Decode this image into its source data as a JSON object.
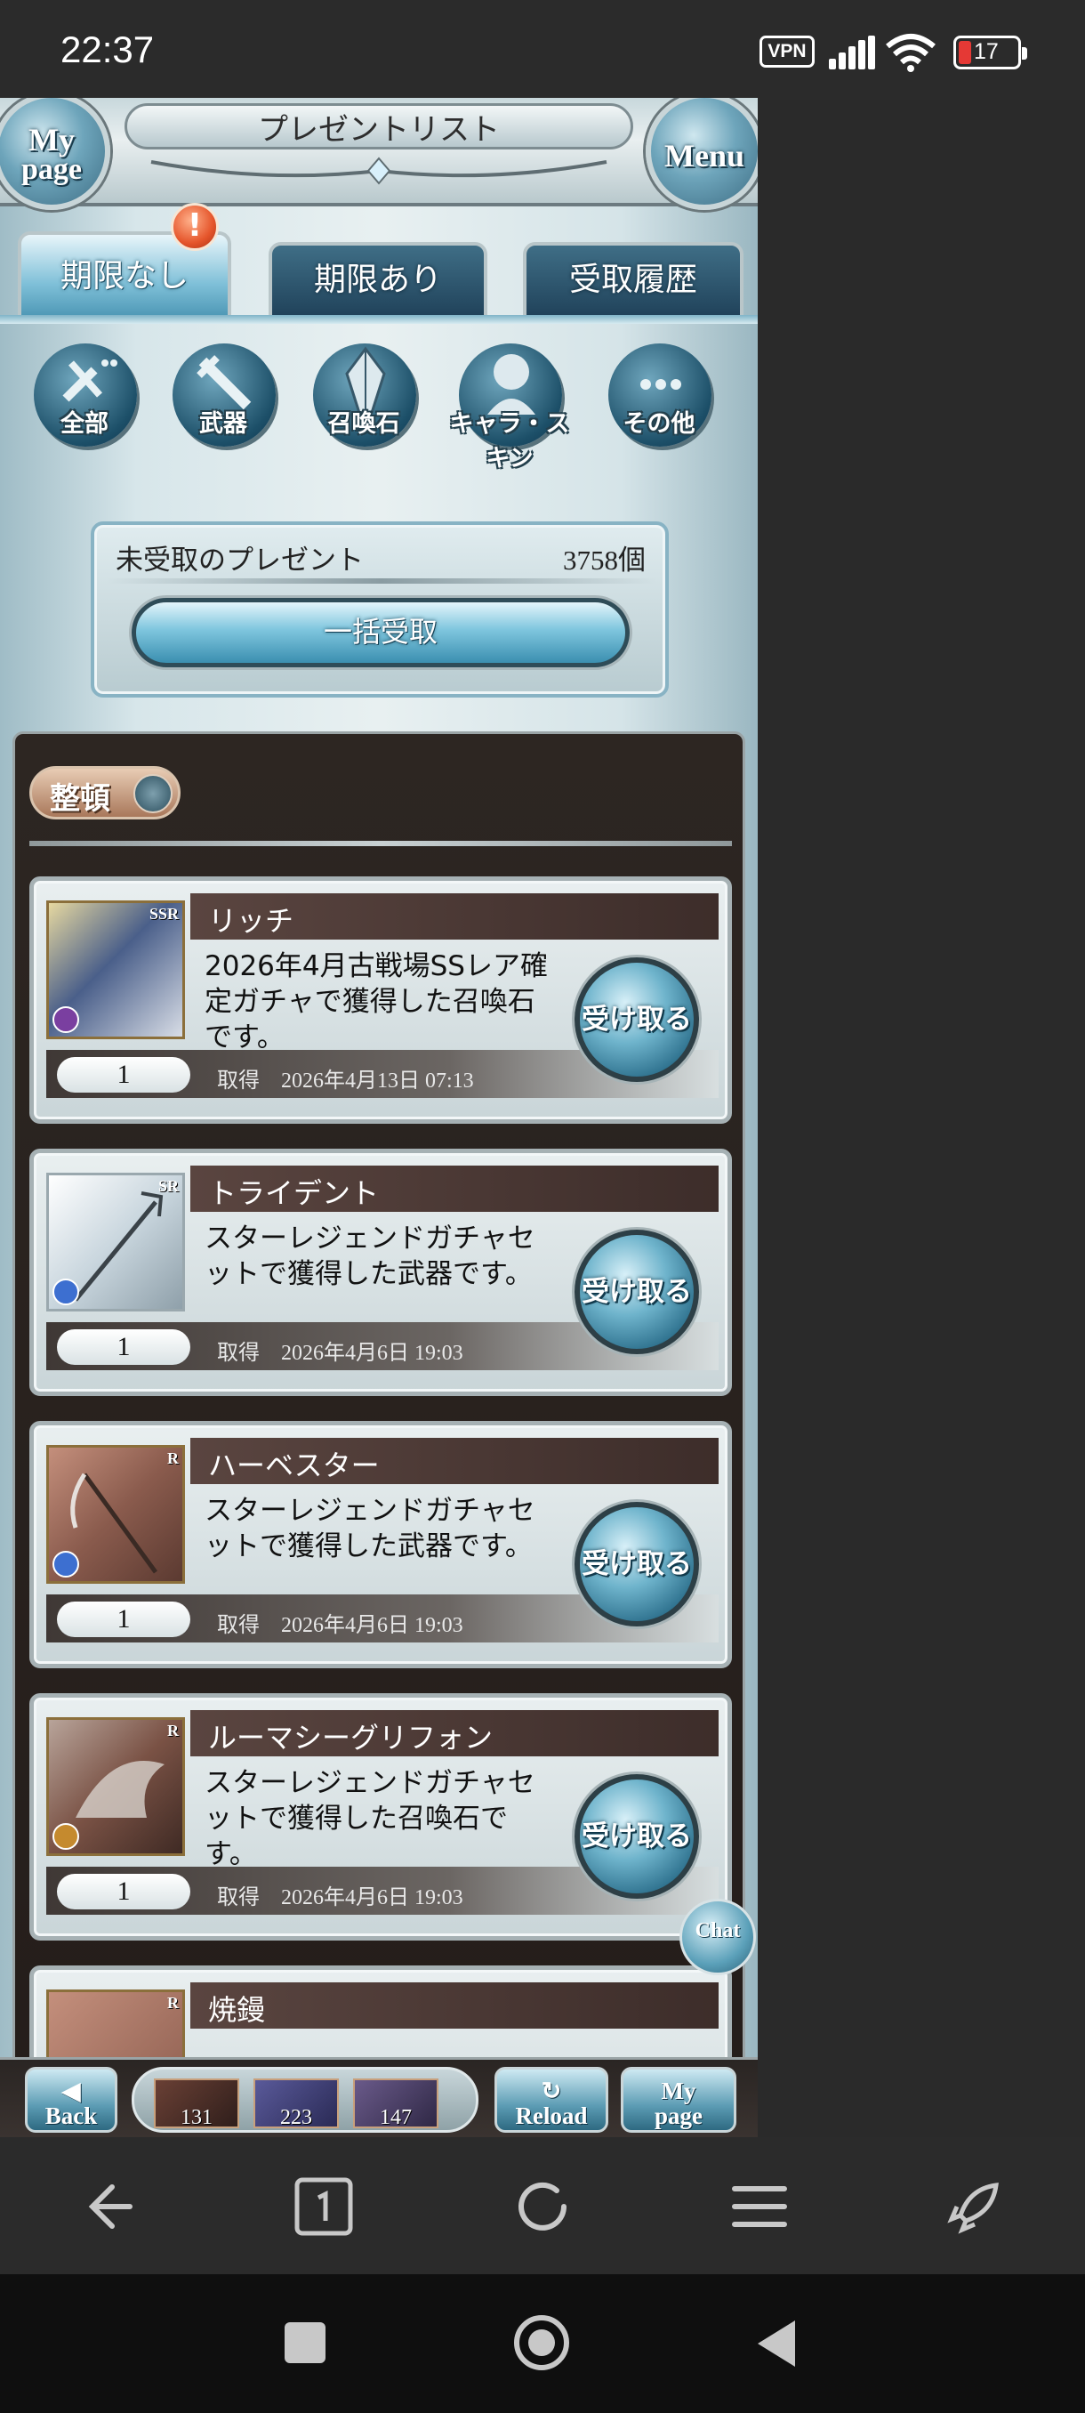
{
  "status_bar": {
    "time": "22:37",
    "vpn": "VPN",
    "battery": "17"
  },
  "header": {
    "title": "プレゼントリスト",
    "mypage_line1": "My",
    "mypage_line2": "page",
    "menu": "Menu"
  },
  "tabs": [
    {
      "label": "期限なし",
      "active": true,
      "badge": "!"
    },
    {
      "label": "期限あり",
      "active": false
    },
    {
      "label": "受取履歴",
      "active": false
    }
  ],
  "categories": [
    {
      "label": "全部",
      "icon": "all-items-icon"
    },
    {
      "label": "武器",
      "icon": "weapon-icon"
    },
    {
      "label": "召喚石",
      "icon": "summon-stone-icon"
    },
    {
      "label": "キャラ・スキン",
      "icon": "character-skin-icon"
    },
    {
      "label": "その他",
      "icon": "other-icon"
    }
  ],
  "receive": {
    "label": "未受取のプレゼント",
    "count": "3758個",
    "button": "一括受取"
  },
  "sort_label": "整頓",
  "items": [
    {
      "name": "リッチ",
      "rarity": "SSR",
      "desc": "2026年4月古戦場SSレア確定ガチャで獲得した召喚石です。",
      "qty": "1",
      "acquired_label": "取得",
      "acquired": "2026年4月13日 07:13",
      "button": "受け取る",
      "thumb_color": "#4a5f8a"
    },
    {
      "name": "トライデント",
      "rarity": "SR",
      "desc": "スターレジェンドガチャセットで獲得した武器です。",
      "qty": "1",
      "acquired_label": "取得",
      "acquired": "2026年4月6日 19:03",
      "button": "受け取る",
      "thumb_color": "#c9d6de"
    },
    {
      "name": "ハーベスター",
      "rarity": "R",
      "desc": "スターレジェンドガチャセットで獲得した武器です。",
      "qty": "1",
      "acquired_label": "取得",
      "acquired": "2026年4月6日 19:03",
      "button": "受け取る",
      "thumb_color": "#8a5b4d"
    },
    {
      "name": "ルーマシーグリフォン",
      "rarity": "R",
      "desc": "スターレジェンドガチャセットで獲得した召喚石です。",
      "qty": "1",
      "acquired_label": "取得",
      "acquired": "2026年4月6日 19:03",
      "button": "受け取る",
      "thumb_color": "#7a5245"
    },
    {
      "name": "焼鏝",
      "rarity": "R",
      "desc": "",
      "qty": "",
      "acquired_label": "",
      "acquired": "",
      "button": "",
      "thumb_color": "#8a5b4d"
    }
  ],
  "chat": "Chat",
  "game_bar": {
    "back_arrow": "◀",
    "back": "Back",
    "reload_icon": "↻",
    "reload": "Reload",
    "mypage_line1": "My",
    "mypage_line2": "page",
    "counts": [
      "131",
      "223",
      "147"
    ]
  },
  "colors": {
    "accent": "#3f8fb0",
    "panel": "#2d2622",
    "badge": "#e5552b"
  }
}
